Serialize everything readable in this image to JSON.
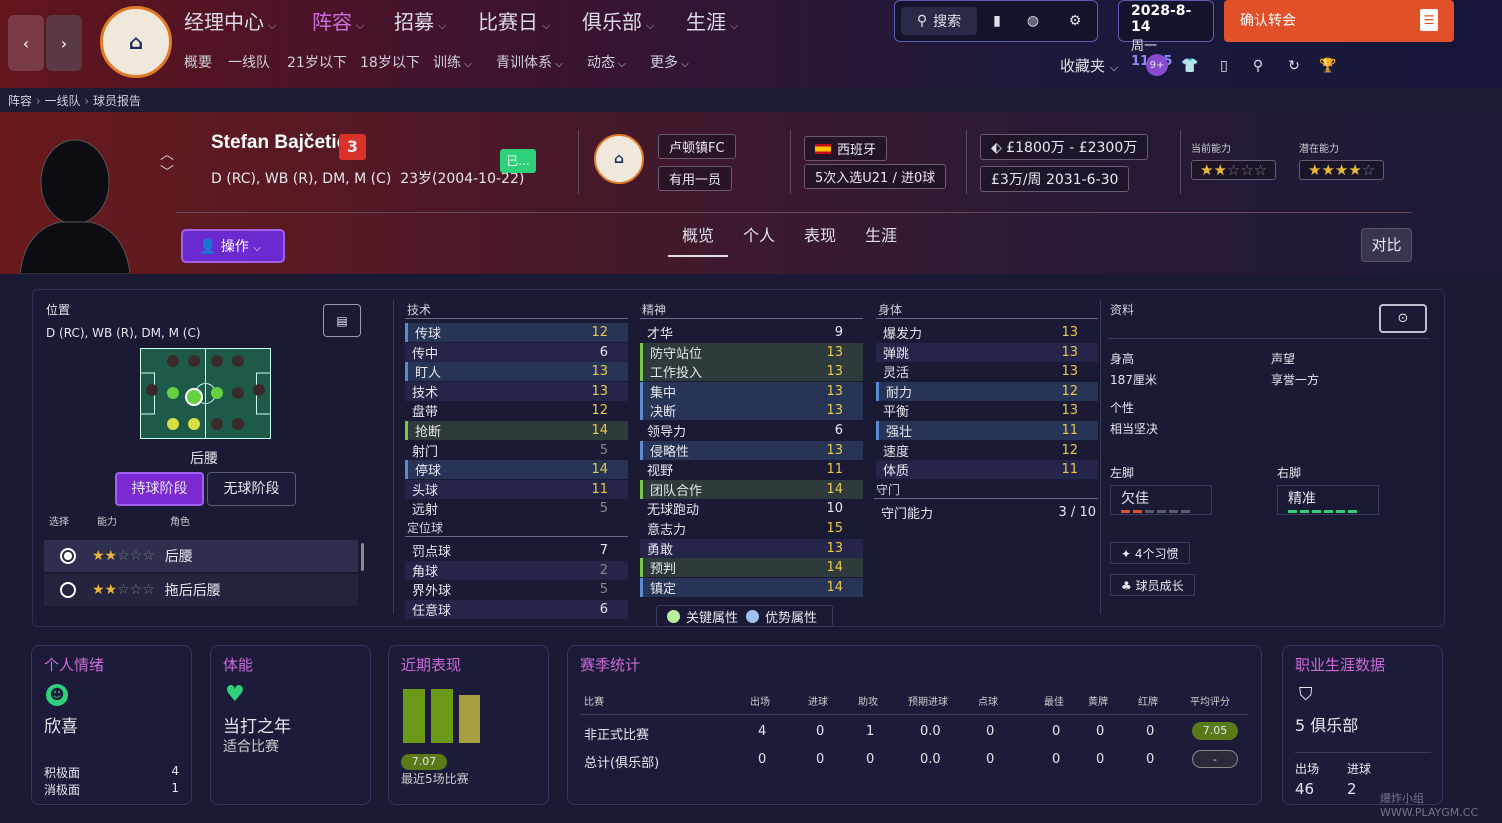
{
  "nav": {
    "back_icon": "chevron-left-icon",
    "forward_icon": "chevron-right-icon",
    "club_crest_text": "LUTON TOWN FOOTBALL CLUB",
    "menus": [
      "经理中心",
      "阵容",
      "招募",
      "比赛日",
      "俱乐部",
      "生涯"
    ],
    "active_menu": "阵容",
    "submenus": [
      "概要",
      "一线队",
      "21岁以下",
      "18岁以下",
      "训练",
      "青训体系",
      "动态",
      "更多"
    ],
    "search_label": "搜索",
    "date": "2028-8-14",
    "weekday": "周一",
    "time": "11:15",
    "continue_label": "确认转会",
    "favorites_label": "收藏夹",
    "notif_badge": "9+"
  },
  "breadcrumb": [
    "阵容",
    "一线队",
    "球员报告"
  ],
  "player": {
    "name": "Stefan Bajčetić",
    "number": "3",
    "positions": "D (RC), WB (R), DM, M (C)",
    "age": "23岁(2004-10-22)",
    "status_badge": "已...",
    "club": "卢顿镇FC",
    "squad_status": "有用一员",
    "nation": "西班牙",
    "caps": "5次入选U21 / 进0球",
    "value": "£1800万 - £2300万",
    "wage": "£3万/周 2031-6-30",
    "current_ability_label": "当前能力",
    "potential_ability_label": "潜在能力",
    "current_ability_stars": 2,
    "potential_ability_stars": 4,
    "action_label": "操作",
    "compare_label": "对比"
  },
  "tabs": [
    "概览",
    "个人",
    "表现",
    "生涯"
  ],
  "position_panel": {
    "title": "位置",
    "positions": "D (RC), WB (R), DM, M (C)",
    "role_name": "后腰",
    "phase_in": "持球阶段",
    "phase_out": "无球阶段",
    "col_select": "选择",
    "col_ability": "能力",
    "col_role": "角色",
    "roles": [
      {
        "name": "后腰",
        "stars": 2,
        "selected": true
      },
      {
        "name": "拖后后腰",
        "stars": 2,
        "selected": false
      }
    ]
  },
  "technical": {
    "title": "技术",
    "items": [
      {
        "name": "传球",
        "value": "12",
        "type": "pref"
      },
      {
        "name": "传中",
        "value": "6",
        "type": "dark"
      },
      {
        "name": "盯人",
        "value": "13",
        "type": "pref"
      },
      {
        "name": "技术",
        "value": "13",
        "type": "dark"
      },
      {
        "name": "盘带",
        "value": "12",
        "type": ""
      },
      {
        "name": "抢断",
        "value": "14",
        "type": "key"
      },
      {
        "name": "射门",
        "value": "5",
        "type": ""
      },
      {
        "name": "停球",
        "value": "14",
        "type": "pref"
      },
      {
        "name": "头球",
        "value": "11",
        "type": "dark"
      },
      {
        "name": "远射",
        "value": "5",
        "type": ""
      }
    ]
  },
  "set_pieces": {
    "title": "定位球",
    "items": [
      {
        "name": "罚点球",
        "value": "7",
        "type": ""
      },
      {
        "name": "角球",
        "value": "2",
        "type": "dark"
      },
      {
        "name": "界外球",
        "value": "5",
        "type": ""
      },
      {
        "name": "任意球",
        "value": "6",
        "type": "dark"
      }
    ]
  },
  "mental": {
    "title": "精神",
    "items": [
      {
        "name": "才华",
        "value": "9",
        "type": ""
      },
      {
        "name": "防守站位",
        "value": "13",
        "type": "key"
      },
      {
        "name": "工作投入",
        "value": "13",
        "type": "key"
      },
      {
        "name": "集中",
        "value": "13",
        "type": "pref"
      },
      {
        "name": "决断",
        "value": "13",
        "type": "pref"
      },
      {
        "name": "领导力",
        "value": "6",
        "type": ""
      },
      {
        "name": "侵略性",
        "value": "13",
        "type": "pref"
      },
      {
        "name": "视野",
        "value": "11",
        "type": ""
      },
      {
        "name": "团队合作",
        "value": "14",
        "type": "key"
      },
      {
        "name": "无球跑动",
        "value": "10",
        "type": ""
      },
      {
        "name": "意志力",
        "value": "15",
        "type": ""
      },
      {
        "name": "勇敢",
        "value": "13",
        "type": "dark"
      },
      {
        "name": "预判",
        "value": "14",
        "type": "key"
      },
      {
        "name": "镇定",
        "value": "14",
        "type": "pref"
      }
    ]
  },
  "physical": {
    "title": "身体",
    "items": [
      {
        "name": "爆发力",
        "value": "13",
        "type": ""
      },
      {
        "name": "弹跳",
        "value": "13",
        "type": "dark"
      },
      {
        "name": "灵活",
        "value": "13",
        "type": ""
      },
      {
        "name": "耐力",
        "value": "12",
        "type": "pref"
      },
      {
        "name": "平衡",
        "value": "13",
        "type": ""
      },
      {
        "name": "强壮",
        "value": "11",
        "type": "pref"
      },
      {
        "name": "速度",
        "value": "12",
        "type": ""
      },
      {
        "name": "体质",
        "value": "11",
        "type": "dark"
      }
    ]
  },
  "goalkeeping": {
    "title": "守门",
    "label": "守门能力",
    "value": "3 / 10"
  },
  "legend": {
    "key": "关键属性",
    "pref": "优势属性"
  },
  "info": {
    "title": "资料",
    "height_label": "身高",
    "height": "187厘米",
    "reputation_label": "声望",
    "reputation": "享誉一方",
    "personality_label": "个性",
    "personality": "相当坚决",
    "left_foot_label": "左脚",
    "left_foot": "欠佳",
    "right_foot_label": "右脚",
    "right_foot": "精准",
    "habits_label": "4个习惯",
    "development_label": "球员成长"
  },
  "morale": {
    "title": "个人情绪",
    "value": "欣喜",
    "positive_label": "积极面",
    "positive": "4",
    "negative_label": "消极面",
    "negative": "1"
  },
  "fitness": {
    "title": "体能",
    "value": "当打之年",
    "subtitle": "适合比赛"
  },
  "form": {
    "title": "近期表现",
    "rating": "7.07",
    "subtitle": "最近5场比赛",
    "bars": [
      0.6,
      0.6,
      0.6
    ]
  },
  "season": {
    "title": "赛季统计",
    "headers": [
      "比赛",
      "出场",
      "进球",
      "助攻",
      "预期进球",
      "点球",
      "最佳",
      "黄牌",
      "红牌",
      "平均评分"
    ],
    "rows": [
      [
        "非正式比赛",
        "4",
        "0",
        "1",
        "0.0",
        "0",
        "0",
        "0",
        "0",
        "7.05"
      ],
      [
        "总计(俱乐部)",
        "0",
        "0",
        "0",
        "0.0",
        "0",
        "0",
        "0",
        "0",
        "-"
      ]
    ]
  },
  "career": {
    "title": "职业生涯数据",
    "clubs": "5 俱乐部",
    "apps_label": "出场",
    "apps": "46",
    "goals_label": "进球",
    "goals": "2"
  },
  "watermark": "爆炸小组 WWW.PLAYGM.CC",
  "colors": {
    "accent": "#c050e0",
    "orange": "#e2502a",
    "green": "#7ac84a",
    "blue": "#5a8ad0",
    "gold": "#e8c84a"
  }
}
